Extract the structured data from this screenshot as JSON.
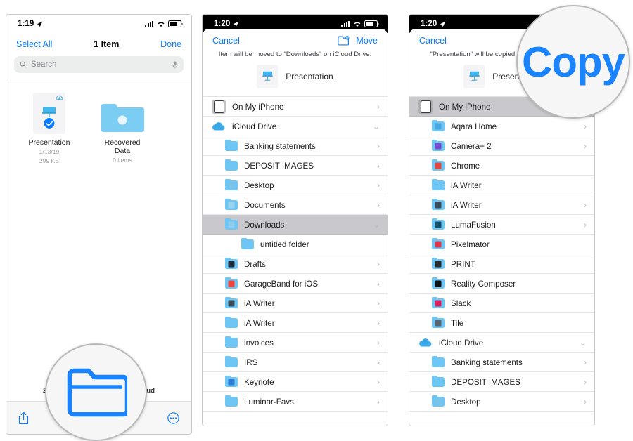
{
  "colors": {
    "accent": "#0a7cff",
    "folder": "#6ec6f5",
    "selected_row": "#c9c9cd",
    "magnifier_text": "#1a84ff"
  },
  "panel1": {
    "status": {
      "time": "1:19",
      "location_icon": "location-arrow-icon",
      "signal_icon": "cellular-signal-icon",
      "wifi_icon": "wifi-icon",
      "battery_icon": "battery-icon"
    },
    "nav": {
      "select_all": "Select All",
      "title": "1 Item",
      "done": "Done"
    },
    "search": {
      "placeholder": "Search",
      "search_icon": "search-icon",
      "mic_icon": "microphone-icon"
    },
    "files": [
      {
        "name": "Presentation",
        "date": "1/13/19",
        "size": "299 KB",
        "icon": "keynote-document-icon",
        "selected": true,
        "cloud_badge": "icloud-download-icon"
      },
      {
        "name": "Recovered Data",
        "date": "",
        "size": "0 items",
        "icon": "folder-icon",
        "selected": false,
        "cloud_badge": ""
      }
    ],
    "footer_text": "2 items, 1.9 GB available on iCloud",
    "toolbar": {
      "share_icon": "share-icon",
      "more_icon": "more-ellipsis-icon"
    }
  },
  "panel2": {
    "status": {
      "time": "1:20",
      "location_icon": "location-arrow-icon",
      "signal_icon": "cellular-signal-icon",
      "wifi_icon": "wifi-icon",
      "battery_icon": "battery-icon"
    },
    "nav": {
      "cancel": "Cancel",
      "new_folder_icon": "new-folder-icon",
      "action": "Move"
    },
    "subtitle": "Item will be moved to “Downloads” on iCloud Drive.",
    "item": {
      "name": "Presentation",
      "icon": "keynote-document-icon"
    },
    "rows": [
      {
        "label": "On My iPhone",
        "icon": "iphone-icon",
        "depth": 0,
        "chevron": "›",
        "selected": false
      },
      {
        "label": "iCloud Drive",
        "icon": "icloud-icon",
        "depth": 0,
        "chevron": "⌄",
        "selected": false
      },
      {
        "label": "Banking statements",
        "icon": "folder-icon",
        "depth": 1,
        "chevron": "›",
        "selected": false
      },
      {
        "label": "DEPOSIT IMAGES",
        "icon": "folder-icon",
        "depth": 1,
        "chevron": "›",
        "selected": false
      },
      {
        "label": "Desktop",
        "icon": "folder-desktop-icon",
        "depth": 1,
        "chevron": "›",
        "selected": false
      },
      {
        "label": "Documents",
        "icon": "folder-documents-icon",
        "depth": 1,
        "chevron": "›",
        "selected": false
      },
      {
        "label": "Downloads",
        "icon": "folder-downloads-icon",
        "depth": 1,
        "chevron": "⌄",
        "selected": true
      },
      {
        "label": "untitled folder",
        "icon": "folder-icon",
        "depth": 2,
        "chevron": "",
        "selected": false
      },
      {
        "label": "Drafts",
        "icon": "folder-drafts-icon",
        "depth": 1,
        "chevron": "›",
        "selected": false
      },
      {
        "label": "GarageBand for iOS",
        "icon": "folder-garageband-icon",
        "depth": 1,
        "chevron": "›",
        "selected": false
      },
      {
        "label": "iA Writer",
        "icon": "folder-iawriter-icon",
        "depth": 1,
        "chevron": "›",
        "selected": false
      },
      {
        "label": "iA Writer",
        "icon": "folder-icon",
        "depth": 1,
        "chevron": "›",
        "selected": false
      },
      {
        "label": "invoices",
        "icon": "folder-icon",
        "depth": 1,
        "chevron": "›",
        "selected": false
      },
      {
        "label": "IRS",
        "icon": "folder-icon",
        "depth": 1,
        "chevron": "›",
        "selected": false
      },
      {
        "label": "Keynote",
        "icon": "folder-keynote-icon",
        "depth": 1,
        "chevron": "›",
        "selected": false
      },
      {
        "label": "Luminar-Favs",
        "icon": "folder-icon",
        "depth": 1,
        "chevron": "›",
        "selected": false
      }
    ]
  },
  "panel3": {
    "status": {
      "time": "1:20",
      "location_icon": "location-arrow-icon",
      "signal_icon": "cellular-signal-icon",
      "wifi_icon": "wifi-icon",
      "battery_icon": "battery-icon"
    },
    "nav": {
      "cancel": "Cancel",
      "new_folder_icon": "new-folder-icon",
      "action": "Copy"
    },
    "subtitle": "“Presentation” will be copied to “On My iPhone”.",
    "item": {
      "name": "Presentation",
      "icon": "keynote-document-icon"
    },
    "rows": [
      {
        "label": "On My iPhone",
        "icon": "iphone-icon",
        "depth": 0,
        "chevron": "⌄",
        "selected": true
      },
      {
        "label": "Aqara Home",
        "icon": "folder-aqara-icon",
        "depth": 1,
        "chevron": "›",
        "selected": false
      },
      {
        "label": "Camera+ 2",
        "icon": "folder-camera-icon",
        "depth": 1,
        "chevron": "›",
        "selected": false
      },
      {
        "label": "Chrome",
        "icon": "folder-chrome-icon",
        "depth": 1,
        "chevron": "",
        "selected": false
      },
      {
        "label": "iA Writer",
        "icon": "folder-icon",
        "depth": 1,
        "chevron": "",
        "selected": false
      },
      {
        "label": "iA Writer",
        "icon": "folder-iawriter-icon",
        "depth": 1,
        "chevron": "›",
        "selected": false
      },
      {
        "label": "LumaFusion",
        "icon": "folder-lumafusion-icon",
        "depth": 1,
        "chevron": "›",
        "selected": false
      },
      {
        "label": "Pixelmator",
        "icon": "folder-pixelmator-icon",
        "depth": 1,
        "chevron": "",
        "selected": false
      },
      {
        "label": "PRINT",
        "icon": "folder-print-icon",
        "depth": 1,
        "chevron": "",
        "selected": false
      },
      {
        "label": "Reality Composer",
        "icon": "folder-reality-icon",
        "depth": 1,
        "chevron": "",
        "selected": false
      },
      {
        "label": "Slack",
        "icon": "folder-slack-icon",
        "depth": 1,
        "chevron": "",
        "selected": false
      },
      {
        "label": "Tile",
        "icon": "folder-tile-icon",
        "depth": 1,
        "chevron": "",
        "selected": false
      },
      {
        "label": "iCloud Drive",
        "icon": "icloud-icon",
        "depth": 0,
        "chevron": "⌄",
        "selected": false
      },
      {
        "label": "Banking statements",
        "icon": "folder-icon",
        "depth": 1,
        "chevron": "›",
        "selected": false
      },
      {
        "label": "DEPOSIT IMAGES",
        "icon": "folder-icon",
        "depth": 1,
        "chevron": "›",
        "selected": false
      },
      {
        "label": "Desktop",
        "icon": "folder-desktop-icon",
        "depth": 1,
        "chevron": "›",
        "selected": false
      }
    ]
  },
  "callouts": [
    {
      "id": "mag-folder",
      "type": "magnifier",
      "content_icon": "folder-outline-icon",
      "text": ""
    },
    {
      "id": "mag-copy",
      "type": "magnifier",
      "content_icon": "",
      "text": "Copy"
    }
  ]
}
